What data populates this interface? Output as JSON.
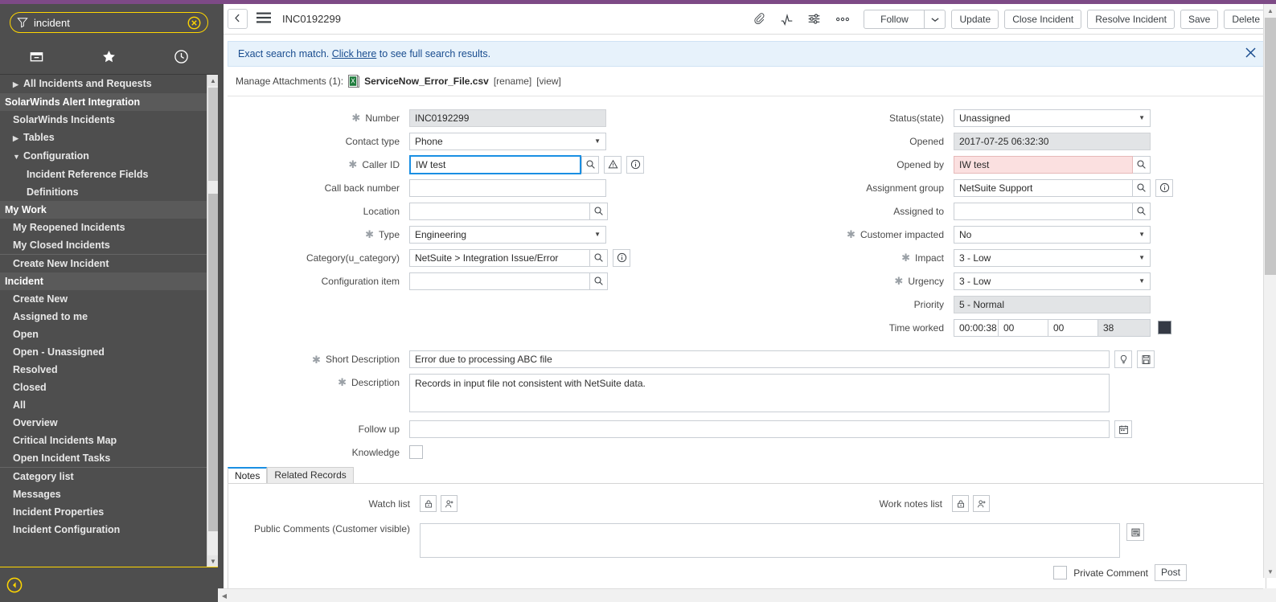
{
  "theme": {
    "purple_bar": "#7d4a86",
    "nav_bg": "#4e4e4e",
    "accent_yellow": "#ffd600",
    "banner_bg": "#e7f2fb",
    "banner_text": "#1a4d8f",
    "focus_blue": "#1a8fe3",
    "error_pink": "#fbe0e0"
  },
  "nav": {
    "search": {
      "value": "incident",
      "filter_icon": "filter-icon",
      "clear_icon": "clear-circle-icon"
    },
    "tabs": [
      {
        "name": "applications-tab",
        "icon": "archive-box-icon"
      },
      {
        "name": "favorites-tab",
        "icon": "star-icon"
      },
      {
        "name": "history-tab",
        "icon": "clock-icon"
      }
    ],
    "items": [
      {
        "label": "All Incidents and Requests",
        "level": 1,
        "type": "expandable",
        "caret": "▶"
      },
      {
        "label": "SolarWinds Alert Integration",
        "level": 0,
        "type": "section"
      },
      {
        "label": "SolarWinds Incidents",
        "level": 1,
        "type": "link"
      },
      {
        "label": "Tables",
        "level": 1,
        "type": "expandable",
        "caret": "▶"
      },
      {
        "label": "Configuration",
        "level": 1,
        "type": "expanded",
        "caret": "▼"
      },
      {
        "label": "Incident Reference Fields",
        "level": 2,
        "type": "link"
      },
      {
        "label": "Definitions",
        "level": 2,
        "type": "link"
      },
      {
        "label": "My Work",
        "level": 0,
        "type": "section"
      },
      {
        "label": "My Reopened Incidents",
        "level": 1,
        "type": "link"
      },
      {
        "label": "My Closed Incidents",
        "level": 1,
        "type": "link"
      },
      {
        "label": "Create New Incident",
        "level": 1,
        "type": "link-sep"
      },
      {
        "label": "Incident",
        "level": 0,
        "type": "section"
      },
      {
        "label": "Create New",
        "level": 1,
        "type": "link"
      },
      {
        "label": "Assigned to me",
        "level": 1,
        "type": "link"
      },
      {
        "label": "Open",
        "level": 1,
        "type": "link"
      },
      {
        "label": "Open - Unassigned",
        "level": 1,
        "type": "link"
      },
      {
        "label": "Resolved",
        "level": 1,
        "type": "link"
      },
      {
        "label": "Closed",
        "level": 1,
        "type": "link"
      },
      {
        "label": "All",
        "level": 1,
        "type": "link"
      },
      {
        "label": "Overview",
        "level": 1,
        "type": "link"
      },
      {
        "label": "Critical Incidents Map",
        "level": 1,
        "type": "link"
      },
      {
        "label": "Open Incident Tasks",
        "level": 1,
        "type": "link"
      },
      {
        "label": "Category list",
        "level": 1,
        "type": "link-sep"
      },
      {
        "label": "Messages",
        "level": 1,
        "type": "link"
      },
      {
        "label": "Incident Properties",
        "level": 1,
        "type": "link"
      },
      {
        "label": "Incident Configuration",
        "level": 1,
        "type": "link"
      }
    ],
    "collapse_icon": "collapse-left-icon"
  },
  "header": {
    "back_icon": "chevron-left-icon",
    "menu_icon": "hamburger-menu-icon",
    "title": "INC0192299",
    "icons": [
      {
        "name": "attachment-icon",
        "glyph": "paperclip"
      },
      {
        "name": "activity-stream-icon",
        "glyph": "activity"
      },
      {
        "name": "personalize-form-icon",
        "glyph": "sliders"
      },
      {
        "name": "more-options-icon",
        "glyph": "dots"
      }
    ],
    "follow_label": "Follow",
    "follow_caret_icon": "chevron-down-icon",
    "buttons": [
      {
        "label": "Update",
        "name": "update-button"
      },
      {
        "label": "Close Incident",
        "name": "close-incident-button"
      },
      {
        "label": "Resolve Incident",
        "name": "resolve-incident-button"
      },
      {
        "label": "Save",
        "name": "save-button"
      },
      {
        "label": "Delete",
        "name": "delete-button"
      }
    ]
  },
  "banner": {
    "prefix": "Exact search match.",
    "link": "Click here",
    "suffix": "to see full search results.",
    "close_icon": "close-icon"
  },
  "attachments": {
    "label": "Manage Attachments (1):",
    "file_icon": "csv-file-icon",
    "filename": "ServiceNow_Error_File.csv",
    "rename": "[rename]",
    "view": "[view]"
  },
  "form": {
    "left": {
      "number": {
        "label": "Number",
        "value": "INC0192299",
        "required": true,
        "readonly": true
      },
      "contact_type": {
        "label": "Contact type",
        "value": "Phone",
        "required": false
      },
      "caller_id": {
        "label": "Caller ID",
        "value": "IW test",
        "required": true,
        "focused": true
      },
      "call_back_number": {
        "label": "Call back number",
        "value": "",
        "required": false
      },
      "location": {
        "label": "Location",
        "value": "",
        "required": false
      },
      "type": {
        "label": "Type",
        "value": "Engineering",
        "required": true
      },
      "category": {
        "label": "Category(u_category)",
        "value": "NetSuite > Integration Issue/Error",
        "required": false
      },
      "configuration_item": {
        "label": "Configuration item",
        "value": "",
        "required": false
      }
    },
    "right": {
      "status": {
        "label": "Status(state)",
        "value": "Unassigned",
        "required": false
      },
      "opened": {
        "label": "Opened",
        "value": "2017-07-25 06:32:30",
        "required": false,
        "readonly": true
      },
      "opened_by": {
        "label": "Opened by",
        "value": "IW test",
        "required": false,
        "error": true
      },
      "assignment_group": {
        "label": "Assignment group",
        "value": "NetSuite Support",
        "required": false
      },
      "assigned_to": {
        "label": "Assigned to",
        "value": "",
        "required": false
      },
      "customer_impacted": {
        "label": "Customer impacted",
        "value": "No",
        "required": true
      },
      "impact": {
        "label": "Impact",
        "value": "3 - Low",
        "required": true
      },
      "urgency": {
        "label": "Urgency",
        "value": "3 - Low",
        "required": true
      },
      "priority": {
        "label": "Priority",
        "value": "5 - Normal",
        "required": false,
        "readonly": true
      },
      "time_worked": {
        "label": "Time worked",
        "total": "00:00:38",
        "hours": "00",
        "minutes": "00",
        "seconds": "38"
      }
    },
    "full": {
      "short_description": {
        "label": "Short Description",
        "value": "Error due to processing ABC file",
        "required": true
      },
      "description": {
        "label": "Description",
        "value": "Records in input file not consistent with NetSuite data.",
        "required": true
      },
      "follow_up": {
        "label": "Follow up",
        "value": "",
        "required": false
      },
      "knowledge": {
        "label": "Knowledge",
        "checked": false
      }
    },
    "icons": {
      "lookup": "magnifier-icon",
      "warning": "warning-triangle-icon",
      "info": "info-circle-icon",
      "lightbulb": "lightbulb-icon",
      "template": "template-icon",
      "calendar": "calendar-icon"
    }
  },
  "tabs": [
    {
      "label": "Notes",
      "name": "tab-notes",
      "active": true
    },
    {
      "label": "Related Records",
      "name": "tab-related-records",
      "active": false
    }
  ],
  "notes": {
    "watch_list_label": "Watch list",
    "work_notes_label": "Work notes list",
    "public_comments_label": "Public Comments (Customer visible)",
    "lock_icon": "lock-icon",
    "add_user_icon": "add-user-icon",
    "expand_icon": "expand-text-icon",
    "private_comment_label": "Private Comment",
    "post_label": "Post"
  }
}
